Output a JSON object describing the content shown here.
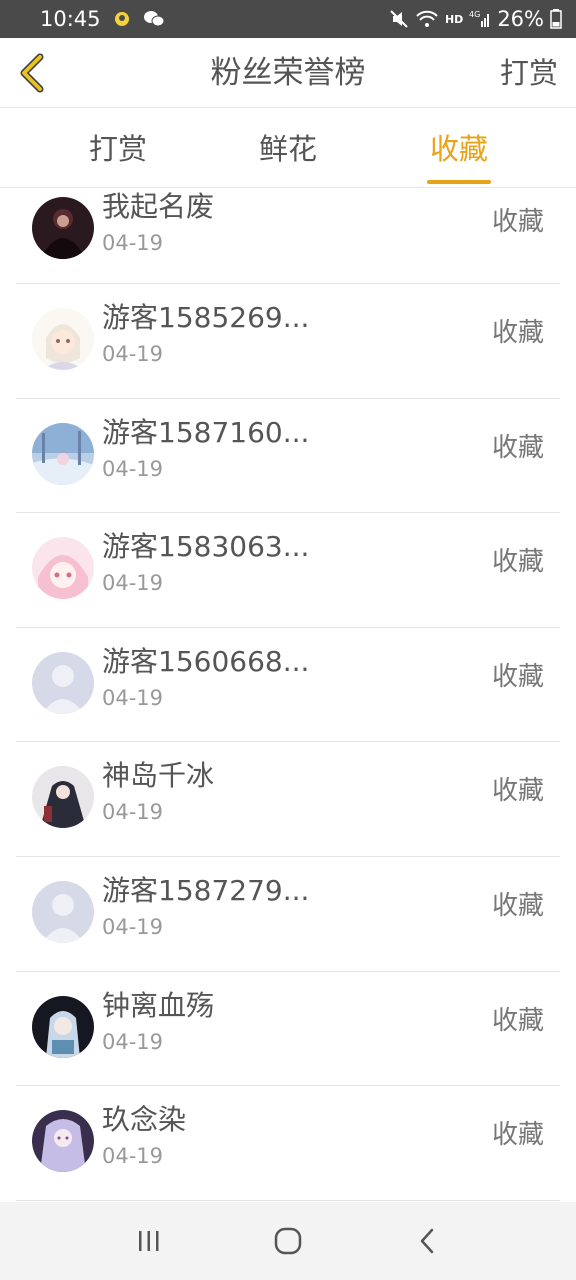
{
  "status_bar": {
    "time": "10:45",
    "network": "HD",
    "signal_label": "4G",
    "battery": "26%"
  },
  "header": {
    "title": "粉丝荣誉榜",
    "action_label": "打赏"
  },
  "tabs": [
    {
      "label": "打赏",
      "active": false
    },
    {
      "label": "鲜花",
      "active": false
    },
    {
      "label": "收藏",
      "active": true
    }
  ],
  "rows": [
    {
      "name": "我起名废",
      "date": "04-19",
      "action": "收藏",
      "avatar": "dark-hooded-figure"
    },
    {
      "name": "游客1585269...",
      "date": "04-19",
      "action": "收藏",
      "avatar": "anime-girl-white-hair"
    },
    {
      "name": "游客1587160...",
      "date": "04-19",
      "action": "收藏",
      "avatar": "winter-scene"
    },
    {
      "name": "游客1583063...",
      "date": "04-19",
      "action": "收藏",
      "avatar": "pink-anime-girl"
    },
    {
      "name": "游客1560668...",
      "date": "04-19",
      "action": "收藏",
      "avatar": "default-user"
    },
    {
      "name": "神岛千冰",
      "date": "04-19",
      "action": "收藏",
      "avatar": "anime-dark-character"
    },
    {
      "name": "游客1587279...",
      "date": "04-19",
      "action": "收藏",
      "avatar": "default-user"
    },
    {
      "name": "钟离血殇",
      "date": "04-19",
      "action": "收藏",
      "avatar": "anime-blue-hair"
    },
    {
      "name": "玖念染",
      "date": "04-19",
      "action": "收藏",
      "avatar": "anime-purple-hair"
    }
  ],
  "colors": {
    "accent": "#e8a317",
    "back_arrow": "#e8c21f",
    "status_bar": "#4a4a4a"
  }
}
